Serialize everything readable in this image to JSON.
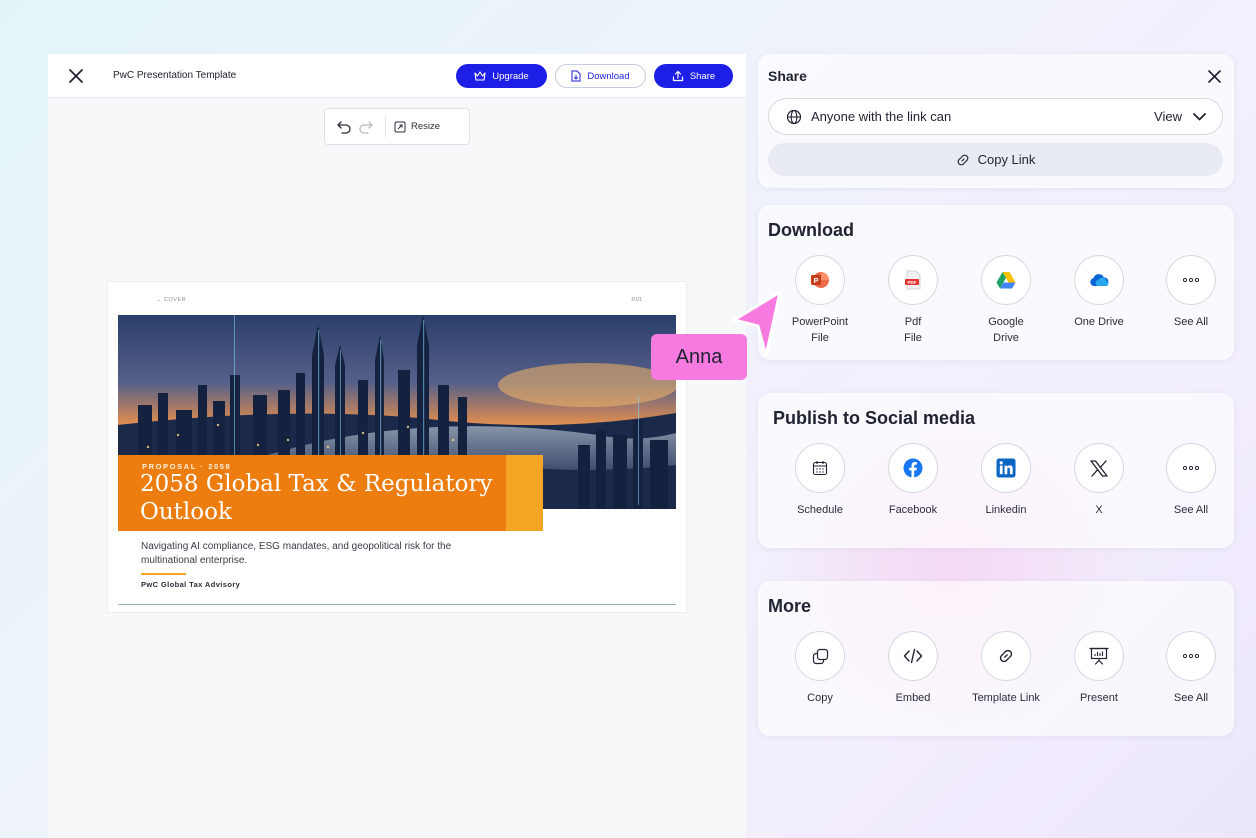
{
  "editor": {
    "doc_title": "PwC Presentation Template",
    "upgrade_label": "Upgrade",
    "download_label": "Download",
    "share_label": "Share",
    "resize_label": "Resize"
  },
  "slide": {
    "cover_label": "→ COVER",
    "page_label": "P.01",
    "eyebrow": "PROPOSAL · 2058",
    "title": "2058 Global Tax & Regulatory Outlook",
    "subtitle": "Navigating AI compliance, ESG mandates, and geopolitical risk for the multinational enterprise.",
    "brand": "PwC Global Tax Advisory"
  },
  "share": {
    "title": "Share",
    "permission_label": "Anyone with the link can",
    "permission_value": "View",
    "copy_link_label": "Copy Link"
  },
  "download": {
    "title": "Download",
    "items": [
      {
        "line1": "PowerPoint",
        "line2": "File"
      },
      {
        "line1": "Pdf",
        "line2": "File"
      },
      {
        "line1": "Google",
        "line2": "Drive"
      },
      {
        "line1": "One Drive",
        "line2": ""
      },
      {
        "line1": "See All",
        "line2": ""
      }
    ]
  },
  "social": {
    "title": "Publish to Social media",
    "items": [
      {
        "label": "Schedule"
      },
      {
        "label": "Facebook"
      },
      {
        "label": "Linkedin"
      },
      {
        "label": "X"
      },
      {
        "label": "See All"
      }
    ]
  },
  "more": {
    "title": "More",
    "items": [
      {
        "label": "Copy"
      },
      {
        "label": "Embed"
      },
      {
        "label": "Template Link"
      },
      {
        "label": "Present"
      },
      {
        "label": "See All"
      }
    ]
  },
  "collaborator": {
    "name": "Anna",
    "color": "#f67ae0"
  },
  "colors": {
    "primary": "#1d1ee6",
    "orange": "#ed7d0f",
    "orange_accent": "#f4a524"
  }
}
